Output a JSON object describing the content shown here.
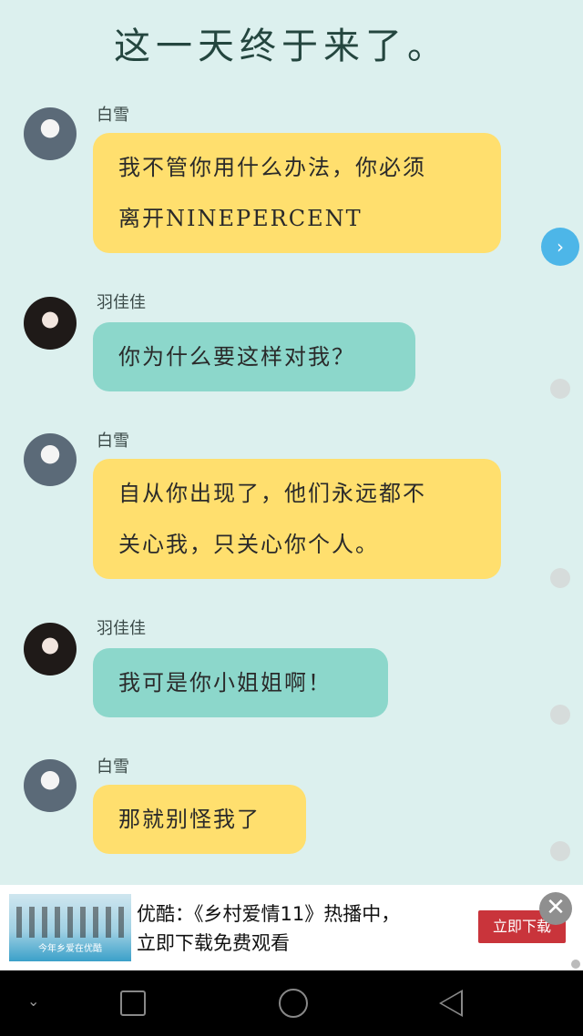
{
  "title": "这一天终于来了。",
  "messages": [
    {
      "sender": "白雪",
      "lines": [
        "我不管你用什么办法，你必须",
        "离开NINEPERCENT"
      ],
      "color": "#ffdf6e"
    },
    {
      "sender": "羽佳佳",
      "lines": [
        "你为什么要这样对我？"
      ],
      "color": "#8cd7cb"
    },
    {
      "sender": "白雪",
      "lines": [
        "自从你出现了，他们永远都不",
        "关心我，只关心你个人。"
      ],
      "color": "#ffdf6e"
    },
    {
      "sender": "羽佳佳",
      "lines": [
        "我可是你小姐姐啊！"
      ],
      "color": "#8cd7cb"
    },
    {
      "sender": "白雪",
      "lines": [
        "那就别怪我了"
      ],
      "color": "#ffdf6e"
    }
  ],
  "next_icon": "›",
  "ad": {
    "thumb_caption": "今年乡爱在优酷",
    "line1": "优酷：《乡村爱情11》热播中，",
    "line2": "立即下载免费观看",
    "download_label": "立即下载",
    "close_icon": "✕"
  },
  "nav": {
    "down_icon": "⌄"
  }
}
